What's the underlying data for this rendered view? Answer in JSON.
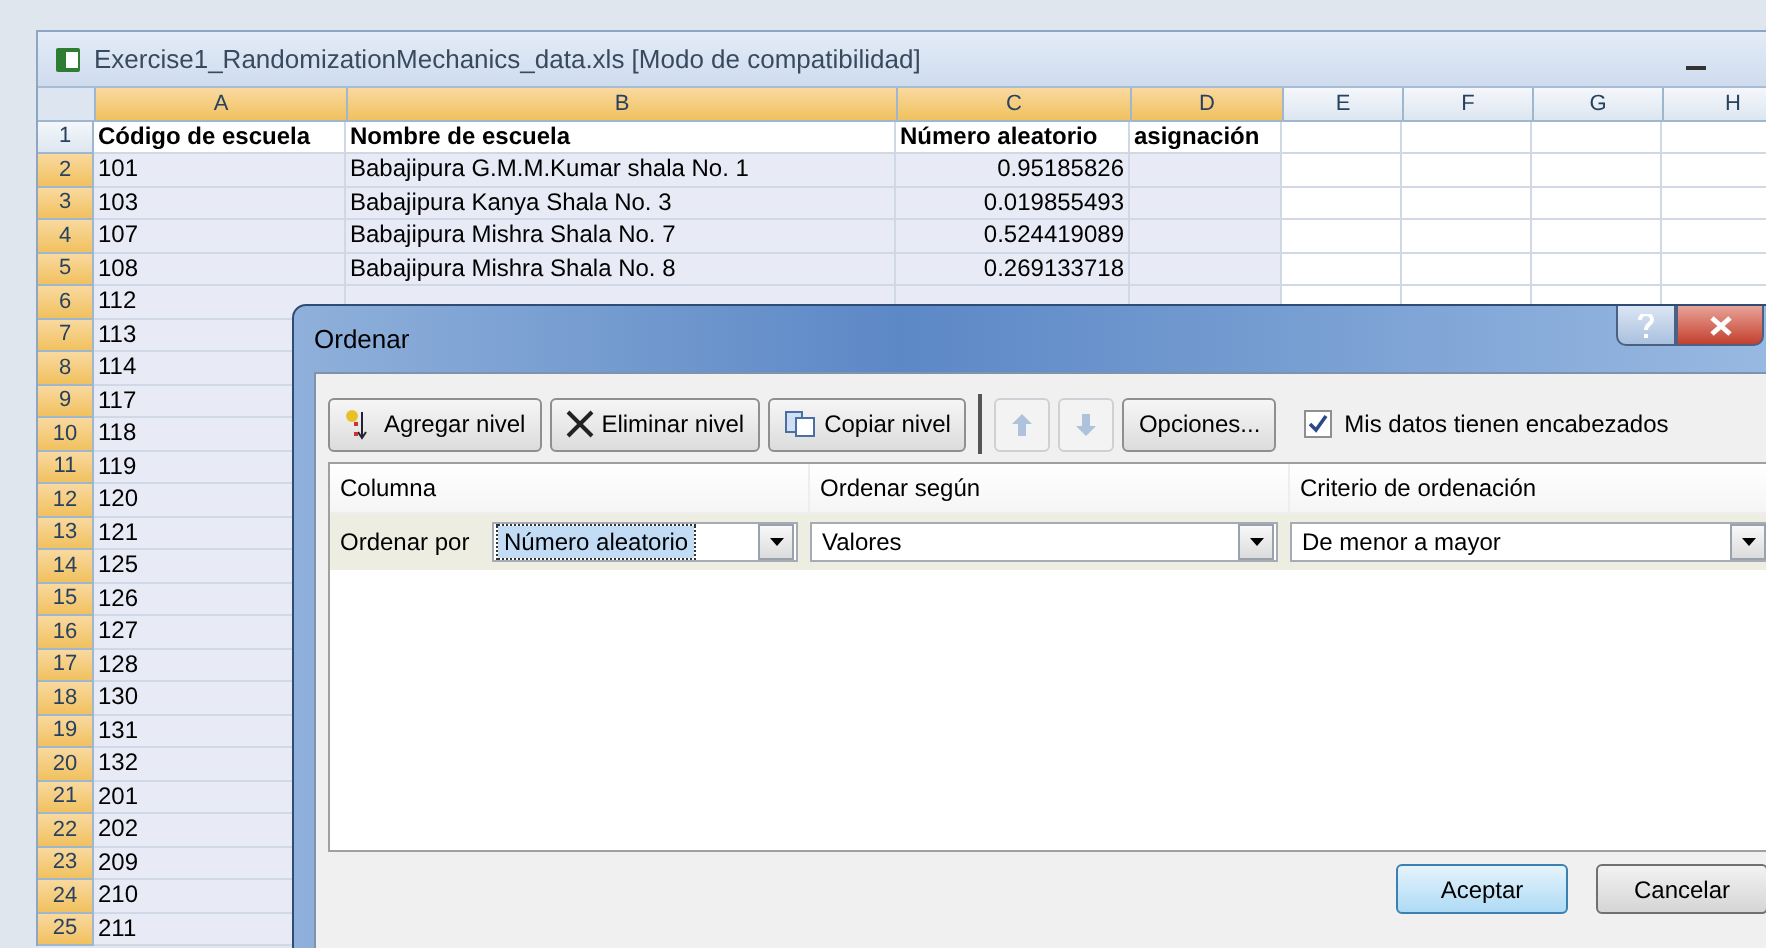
{
  "window": {
    "title": "Exercise1_RandomizationMechanics_data.xls  [Modo de compatibilidad]"
  },
  "sheet": {
    "columns": [
      {
        "label": "A",
        "selected": true
      },
      {
        "label": "B",
        "selected": true
      },
      {
        "label": "C",
        "selected": true
      },
      {
        "label": "D",
        "selected": true
      },
      {
        "label": "E",
        "selected": false
      },
      {
        "label": "F",
        "selected": false
      },
      {
        "label": "G",
        "selected": false
      },
      {
        "label": "H",
        "selected": false
      }
    ],
    "rows": [
      {
        "number": "1",
        "selected": false,
        "cells": [
          "Código de escuela",
          "Nombre de escuela",
          "Número aleatorio",
          "asignación"
        ]
      },
      {
        "number": "2",
        "selected": true,
        "cells": [
          "101",
          "Babajipura G.M.M.Kumar shala No. 1",
          "0.95185826"
        ]
      },
      {
        "number": "3",
        "selected": true,
        "cells": [
          "103",
          "Babajipura Kanya Shala No. 3",
          "0.019855493"
        ]
      },
      {
        "number": "4",
        "selected": true,
        "cells": [
          "107",
          "Babajipura Mishra Shala No. 7",
          "0.524419089"
        ]
      },
      {
        "number": "5",
        "selected": true,
        "cells": [
          "108",
          "Babajipura Mishra Shala No. 8",
          "0.269133718"
        ]
      },
      {
        "number": "6",
        "selected": true,
        "cells": [
          "112"
        ]
      },
      {
        "number": "7",
        "selected": true,
        "cells": [
          "113"
        ]
      },
      {
        "number": "8",
        "selected": true,
        "cells": [
          "114"
        ]
      },
      {
        "number": "9",
        "selected": true,
        "cells": [
          "117"
        ]
      },
      {
        "number": "10",
        "selected": true,
        "cells": [
          "118"
        ]
      },
      {
        "number": "11",
        "selected": true,
        "cells": [
          "119"
        ]
      },
      {
        "number": "12",
        "selected": true,
        "cells": [
          "120"
        ]
      },
      {
        "number": "13",
        "selected": true,
        "cells": [
          "121"
        ]
      },
      {
        "number": "14",
        "selected": true,
        "cells": [
          "125"
        ]
      },
      {
        "number": "15",
        "selected": true,
        "cells": [
          "126"
        ]
      },
      {
        "number": "16",
        "selected": true,
        "cells": [
          "127"
        ]
      },
      {
        "number": "17",
        "selected": true,
        "cells": [
          "128"
        ]
      },
      {
        "number": "18",
        "selected": true,
        "cells": [
          "130"
        ]
      },
      {
        "number": "19",
        "selected": true,
        "cells": [
          "131"
        ]
      },
      {
        "number": "20",
        "selected": true,
        "cells": [
          "132"
        ]
      },
      {
        "number": "21",
        "selected": true,
        "cells": [
          "201"
        ]
      },
      {
        "number": "22",
        "selected": true,
        "cells": [
          "202"
        ]
      },
      {
        "number": "23",
        "selected": true,
        "cells": [
          "209"
        ]
      },
      {
        "number": "24",
        "selected": true,
        "cells": [
          "210"
        ]
      },
      {
        "number": "25",
        "selected": true,
        "cells": [
          "211"
        ]
      }
    ]
  },
  "dialog": {
    "title": "Ordenar",
    "toolbar": [
      {
        "kind": "add",
        "label": "Agregar nivel",
        "disabled": false
      },
      {
        "kind": "delete",
        "label": "Eliminar nivel",
        "disabled": false
      },
      {
        "kind": "copy",
        "label": "Copiar nivel",
        "disabled": false
      },
      {
        "kind": "up",
        "disabled": true
      },
      {
        "kind": "down",
        "disabled": true
      },
      {
        "kind": "text",
        "label": "Opciones...",
        "disabled": false
      }
    ],
    "headers_checkbox": {
      "label": "Mis datos tienen encabezados",
      "checked": true
    },
    "columns": [
      "Columna",
      "Ordenar según",
      "Criterio de ordenación"
    ],
    "levels": [
      {
        "label": "Ordenar por",
        "column": "Número aleatorio",
        "sort_on": "Valores",
        "order": "De menor a mayor",
        "selected": true
      }
    ],
    "buttons": [
      {
        "label": "Aceptar",
        "default": true
      },
      {
        "label": "Cancelar",
        "default": false
      }
    ]
  }
}
